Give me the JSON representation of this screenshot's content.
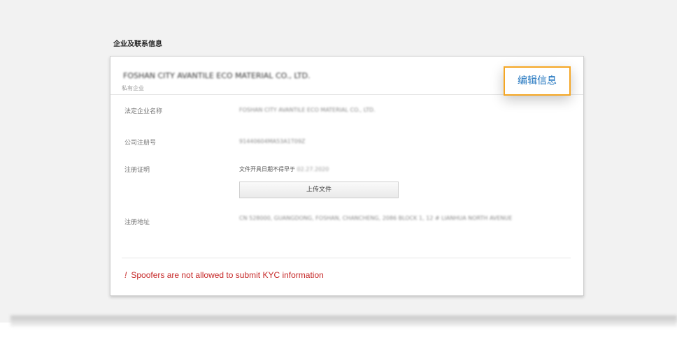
{
  "section": {
    "title": "企业及联系信息"
  },
  "company": {
    "name": "FOSHAN CITY AVANTILE ECO MATERIAL CO., LTD.",
    "type": "私有企业",
    "edit_label": "编辑信息"
  },
  "fields": {
    "legal_name": {
      "label": "法定企业名称",
      "value": "FOSHAN CITY AVANTILE ECO MATERIAL CO., LTD."
    },
    "reg_number": {
      "label": "公司注册号",
      "value": "91440604MA53A1T09Z"
    },
    "reg_cert": {
      "label": "注册证明",
      "note": "文件开具日期不得早于",
      "note_date": "02.27.2020",
      "upload_label": "上传文件"
    },
    "reg_address": {
      "label": "注册地址",
      "value": "CN 528000, GUANGDONG, FOSHAN, CHANCHENG, 2086 BLOCK 1, 12 # LIANHUA NORTH AVENUE"
    }
  },
  "error": {
    "mark": "!",
    "text": "Spoofers are not allowed to submit KYC information",
    "color": "#c62828"
  },
  "colors": {
    "accent": "#1e73be",
    "highlight_border": "#f5a623"
  }
}
